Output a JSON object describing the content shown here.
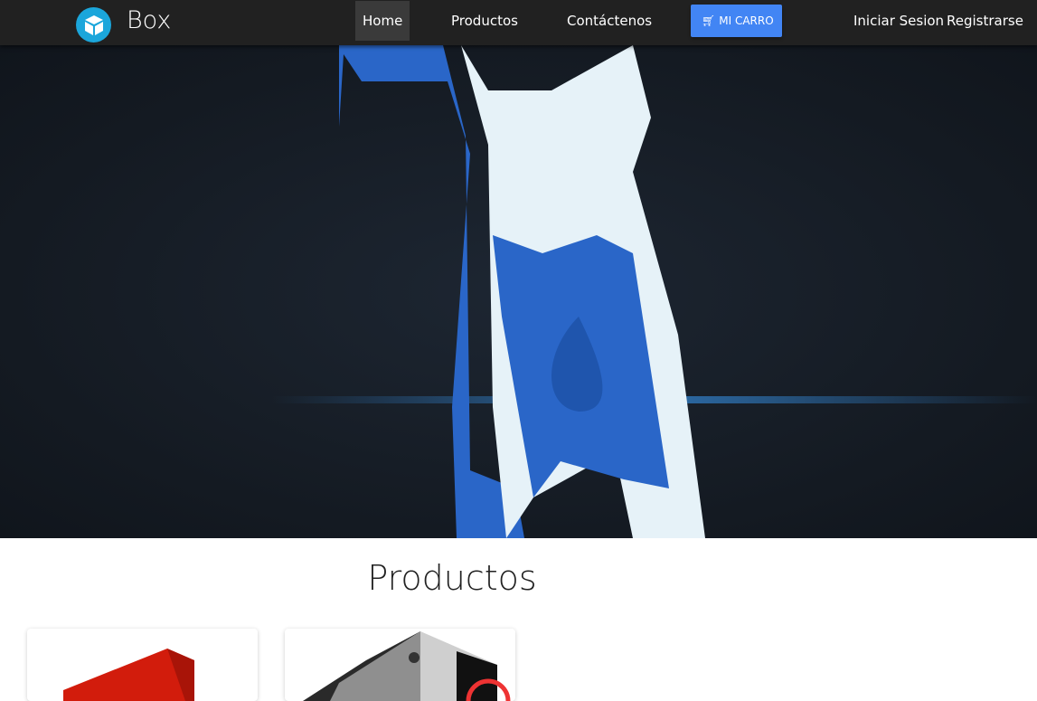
{
  "navbar": {
    "brand": "Box",
    "links": [
      {
        "label": "Home",
        "active": true
      },
      {
        "label": "Productos"
      },
      {
        "label": "Contáctenos"
      }
    ],
    "cart_label": "MI CARRO",
    "login": "Iniciar Sesion",
    "register": "Registrarse",
    "colors": {
      "bar": "#212121",
      "cart": "#4285f4",
      "logo": "#1ba6db"
    }
  },
  "hero": {
    "image": "blue-white-pc-case-render"
  },
  "products": {
    "title": "Productos",
    "items": [
      {
        "image": "red-graphics-card-box"
      },
      {
        "image": "black-glass-pc-case"
      }
    ]
  }
}
